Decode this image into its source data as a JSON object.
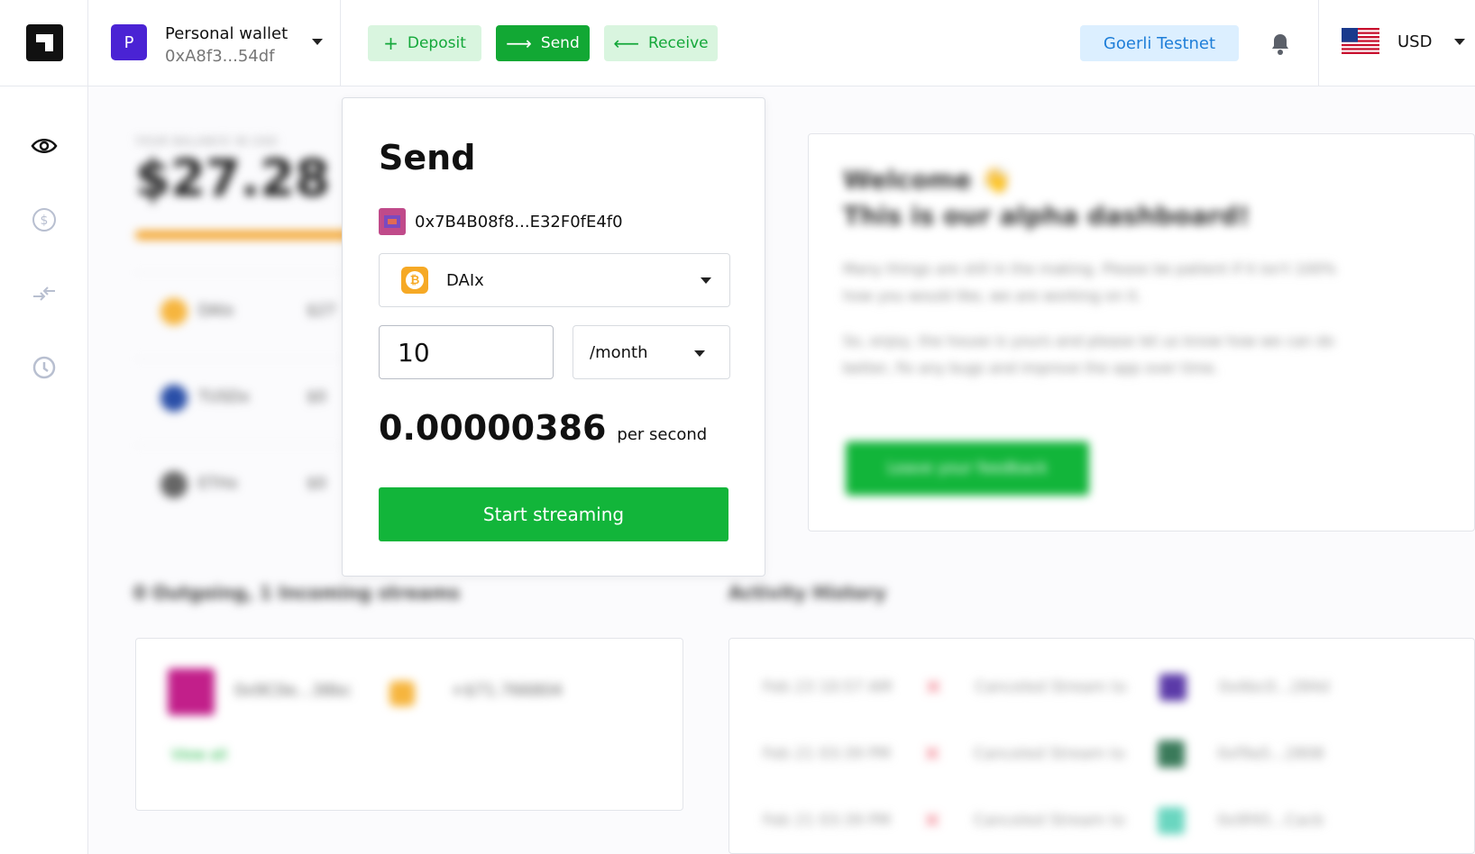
{
  "wallet": {
    "avatar_letter": "P",
    "name": "Personal wallet",
    "address": "0xA8f3...54df"
  },
  "actions": {
    "deposit": "Deposit",
    "send": "Send",
    "receive": "Receive"
  },
  "network": "Goerli Testnet",
  "currency": "USD",
  "colors": {
    "accent_green": "#12b53a",
    "wallet_purple": "#4a23d4",
    "network_blue": "#1e7ed8",
    "balance_bar": "#f4a42b"
  },
  "icons": {
    "sidenav": [
      "eye-icon",
      "dollar-icon",
      "arrows-icon",
      "history-icon"
    ],
    "topbar": [
      "plus-icon",
      "arrow-right-icon",
      "arrow-left-icon",
      "bell-icon",
      "us-flag-icon",
      "chevron-down-icon"
    ]
  },
  "background": {
    "balance_label": "YOUR BALANCE IN USD",
    "balance_value": "$27.28",
    "tokens": [
      {
        "name": "DAIx",
        "amount": "$27"
      },
      {
        "name": "TUSDx",
        "amount": "$0"
      },
      {
        "name": "ETHx",
        "amount": "$0"
      }
    ],
    "welcome": {
      "title_line1": "Welcome 👋",
      "title_line2": "This is our alpha dashboard!",
      "para1": "Many things are still in the making. Please be patient if it isn't 100% how you would like, we are working on it.",
      "para2": "So, enjoy, the house is yours and please let us know how we can do better, fix any bugs and improve the app over time.",
      "button": "Leave your feedback"
    },
    "streams_title": "0 Outgoing, 1 Incoming streams",
    "streams": [
      {
        "address": "0x9C0e...38bc",
        "amount": "+$71.766804",
        "link": "View all"
      }
    ],
    "activity_title": "Activity History",
    "activity": [
      {
        "time": "Feb 23 10:57 AM",
        "text": "Canceled Stream to",
        "address": "0xAbc0...284d"
      },
      {
        "time": "Feb 21 03:39 PM",
        "text": "Canceled Stream to",
        "address": "0xf9a5...2808"
      },
      {
        "time": "Feb 21 03:39 PM",
        "text": "Canceled Stream to",
        "address": "0x9f45...Cacb"
      }
    ]
  },
  "send": {
    "title": "Send",
    "recipient": "0x7B4B08f8...E32F0fE4f0",
    "token": "DAIx",
    "amount": "10",
    "period": "/month",
    "rate": "0.00000386",
    "rate_unit": "per second",
    "button": "Start streaming"
  }
}
